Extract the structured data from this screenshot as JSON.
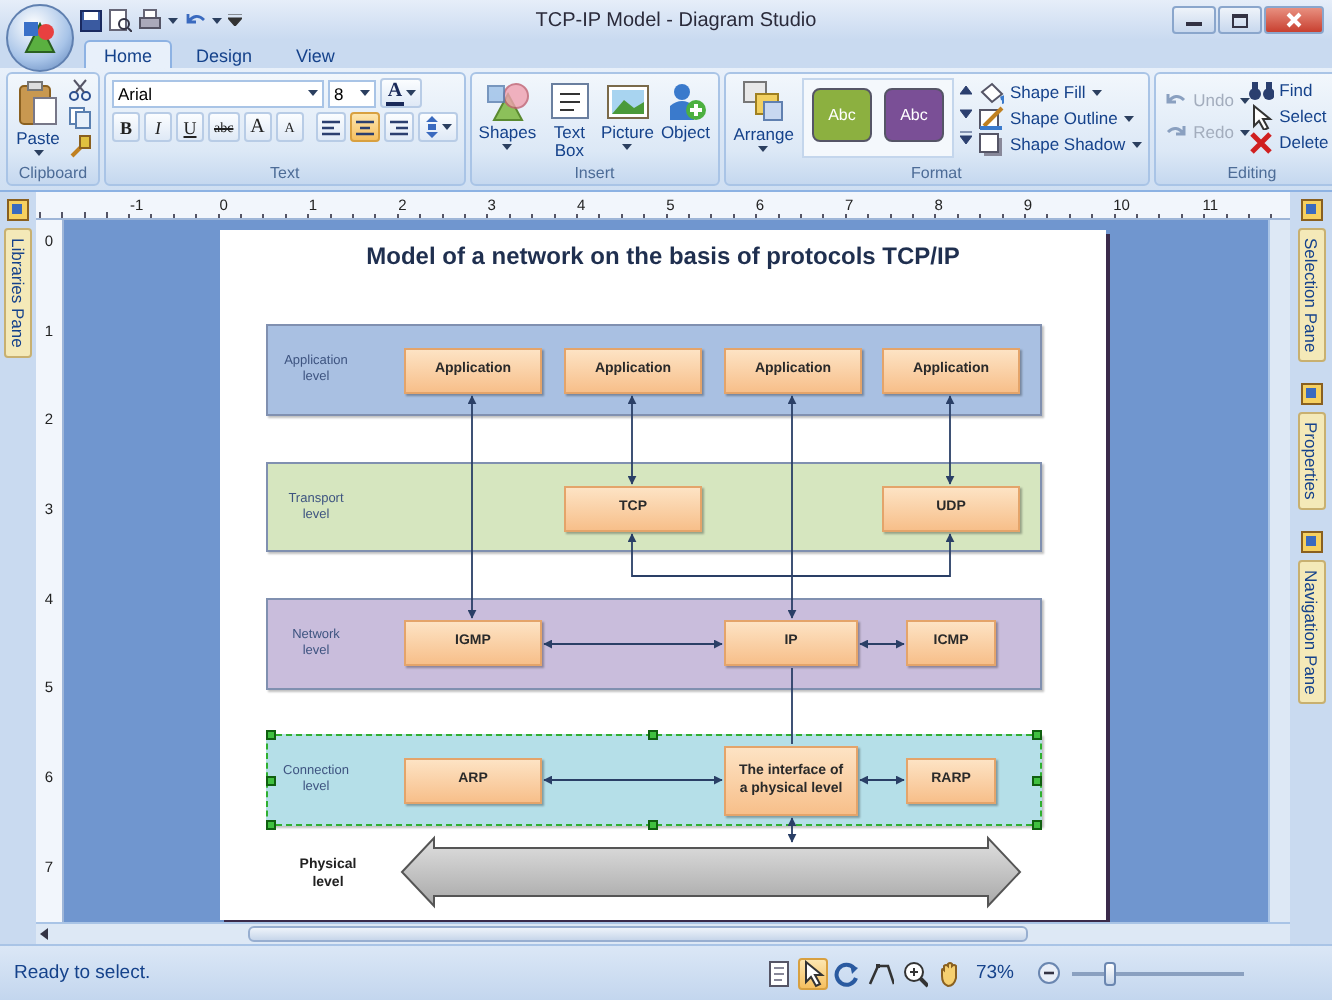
{
  "window": {
    "title": "TCP-IP Model - Diagram Studio"
  },
  "ribbon_tabs": [
    {
      "label": "Home",
      "selected": true
    },
    {
      "label": "Design",
      "selected": false
    },
    {
      "label": "View",
      "selected": false
    }
  ],
  "ribbon_groups": [
    {
      "kind": "clipboard",
      "label": "Clipboard",
      "paste": "Paste"
    },
    {
      "kind": "text",
      "label": "Text",
      "font": "Arial",
      "size": "8",
      "font_color": "A",
      "styles": [
        "B",
        "I",
        "U",
        "abc",
        "A",
        "A"
      ],
      "alignment": [
        {
          "selected": false
        },
        {
          "selected": true
        },
        {
          "selected": false
        }
      ]
    },
    {
      "kind": "insert",
      "label": "Insert",
      "buttons": [
        "Shapes",
        "Text Box",
        "Picture",
        "Object"
      ]
    },
    {
      "kind": "format",
      "label": "Format",
      "arrange": "Arrange",
      "styles": [
        {
          "label": "Abc",
          "color": "#8cb040"
        },
        {
          "label": "Abc",
          "color": "#7a4f96"
        }
      ],
      "commands": [
        "Shape Fill",
        "Shape Outline",
        "Shape Shadow"
      ]
    },
    {
      "kind": "editing",
      "label": "Editing",
      "commands": [
        {
          "label": "Undo",
          "disabled": true
        },
        {
          "label": "Redo",
          "disabled": true
        },
        {
          "label": "Find",
          "disabled": false
        },
        {
          "label": "Select",
          "disabled": false
        },
        {
          "label": "Delete",
          "disabled": false
        }
      ]
    }
  ],
  "left_panes": [
    "Libraries Pane"
  ],
  "right_panes": [
    "Selection Pane",
    "Properties",
    "Navigation Pane"
  ],
  "horizontal_ruler": [
    "-1",
    "0",
    "1",
    "2",
    "3",
    "4",
    "5",
    "6",
    "7",
    "8",
    "9",
    "10",
    "11"
  ],
  "vertical_ruler": [
    "0",
    "1",
    "2",
    "3",
    "4",
    "5",
    "6",
    "7"
  ],
  "diagram": {
    "title": "Model of a network on the basis of protocols TCP/IP",
    "levels": [
      {
        "kind": "band",
        "label": "Application level",
        "color": "#a9c0e2",
        "selected": false,
        "nodes": [
          "Application",
          "Application",
          "Application",
          "Application"
        ]
      },
      {
        "kind": "band",
        "label": "Transport level",
        "color": "#d6e6bf",
        "selected": false,
        "nodes": [
          "TCP",
          "UDP"
        ]
      },
      {
        "kind": "band",
        "label": "Network level",
        "color": "#c9bddc",
        "selected": false,
        "nodes": [
          "IGMP",
          "IP",
          "ICMP"
        ]
      },
      {
        "kind": "band",
        "label": "Connection level",
        "color": "#b5dfe8",
        "selected": true,
        "nodes": [
          "ARP",
          "The interface of a physical level",
          "RARP"
        ]
      },
      {
        "kind": "bus",
        "label": "Physical level"
      }
    ]
  },
  "status_bar": {
    "text": "Ready to select.",
    "tools": [
      {
        "selected": false
      },
      {
        "selected": true
      },
      {
        "selected": false
      },
      {
        "selected": false
      },
      {
        "selected": false
      },
      {
        "selected": false
      }
    ],
    "zoom": "73%",
    "zoom_slider": {
      "level": 0.2
    }
  }
}
